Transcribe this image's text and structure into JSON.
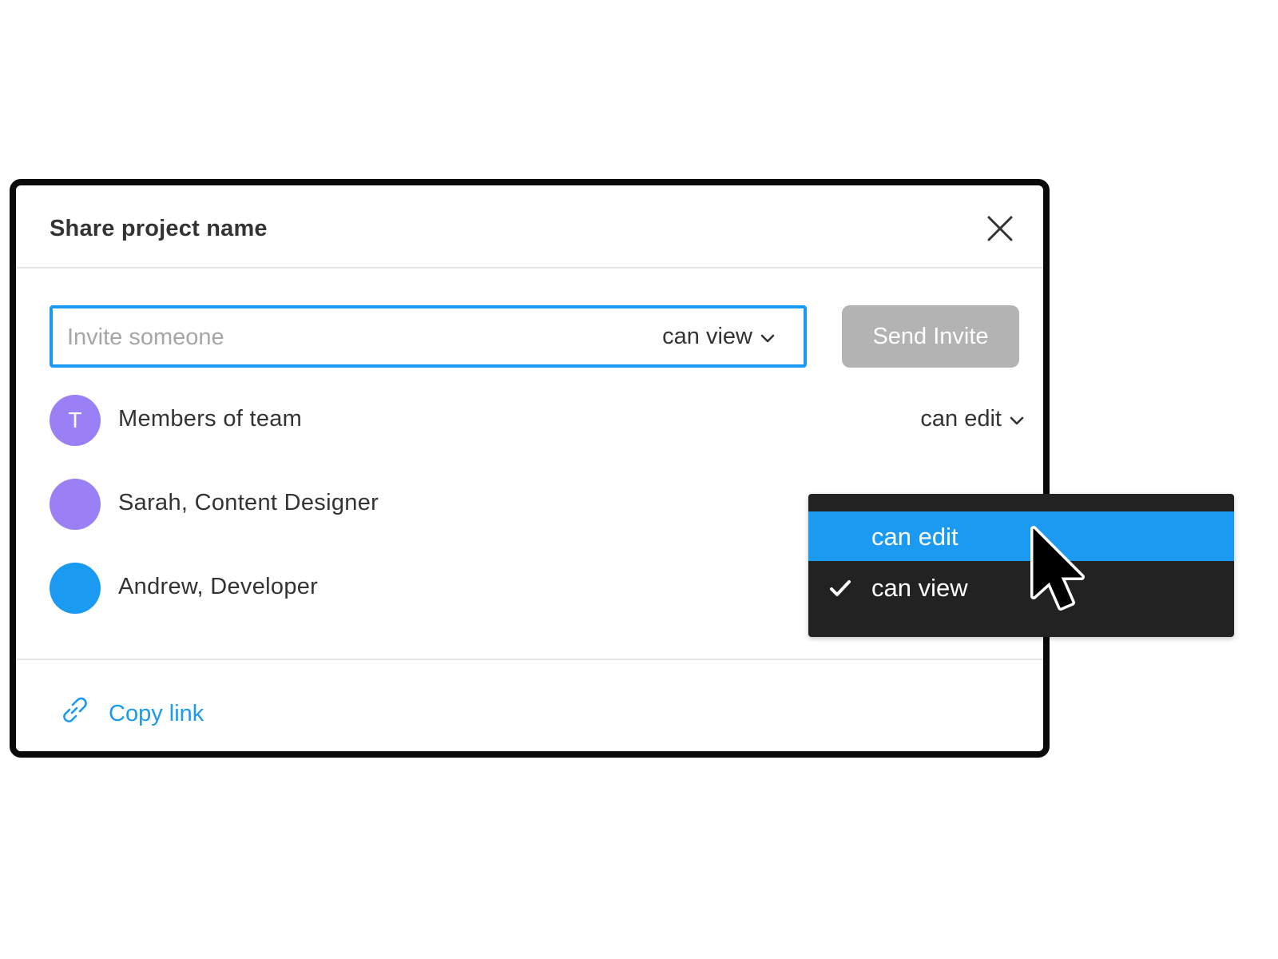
{
  "dialog": {
    "title": "Share project name",
    "close_icon": "close-icon"
  },
  "invite": {
    "placeholder": "Invite someone",
    "value": "",
    "permission": "can view",
    "send_label": "Send Invite"
  },
  "members": [
    {
      "avatar_letter": "T",
      "avatar_color": "#9b7ff5",
      "name": "Members of team",
      "permission": "can edit"
    },
    {
      "avatar_letter": "",
      "avatar_color": "#9b7ff5",
      "name": "Sarah, Content Designer"
    },
    {
      "avatar_letter": "",
      "avatar_color": "#1a9af0",
      "name": "Andrew, Developer"
    }
  ],
  "footer": {
    "copy_link_label": "Copy link",
    "link_icon": "link-icon"
  },
  "dropdown": {
    "options": [
      {
        "label": "can edit",
        "highlighted": true,
        "checked": false
      },
      {
        "label": "can view",
        "highlighted": false,
        "checked": true
      }
    ]
  },
  "colors": {
    "accent": "#1a9af0",
    "avatar_purple": "#9b7ff5",
    "button_disabled": "#b3b3b3",
    "dropdown_bg": "#222222",
    "text": "#333333"
  }
}
